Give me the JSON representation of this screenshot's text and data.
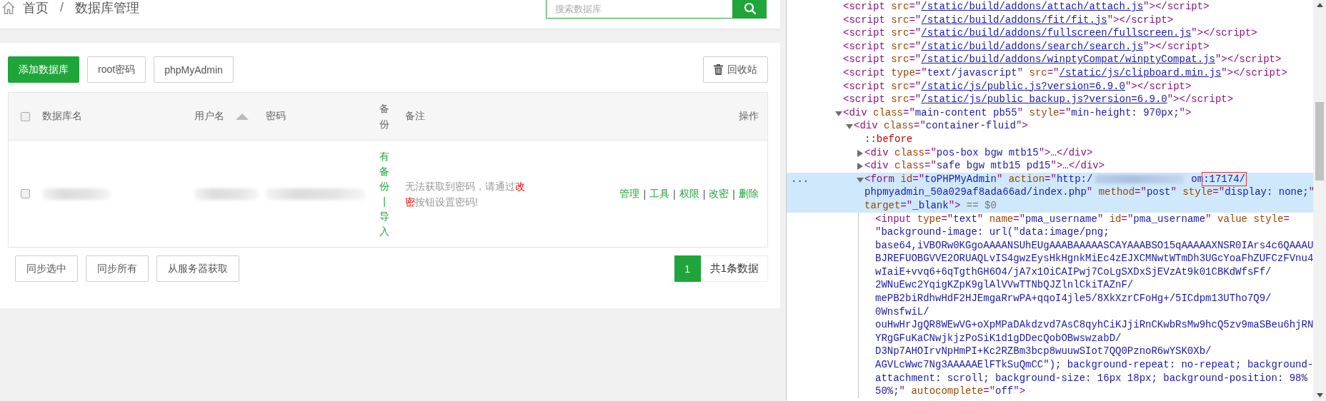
{
  "breadcrumb": {
    "items": [
      "首页",
      "数据库管理"
    ],
    "separator": "/"
  },
  "search": {
    "placeholder": "搜索数据库"
  },
  "toolbar": {
    "buttons": [
      {
        "label": "添加数据库",
        "kind": "primary"
      },
      {
        "label": "root密码",
        "kind": "default"
      },
      {
        "label": "phpMyAdmin",
        "kind": "default"
      }
    ],
    "recycle": "回收站"
  },
  "table": {
    "select_all_checked": false,
    "columns": [
      {
        "label": "数据库名",
        "sorted": false
      },
      {
        "label": "用户名",
        "sorted": true
      },
      {
        "label": "密码",
        "sorted": false
      },
      {
        "label": "备份",
        "sorted": false
      },
      {
        "label": "备注",
        "sorted": false
      },
      {
        "label": "操作",
        "sorted": false
      }
    ],
    "rows": [
      {
        "checked": false,
        "backup_links": [
          "有备份",
          "导入"
        ],
        "backup_separator": "|",
        "note_parts": [
          {
            "kind": "plain",
            "text": "无法获取到密码，请通过"
          },
          {
            "kind": "alert",
            "text": "改密"
          },
          {
            "kind": "plain",
            "text": "按钮设置密码!"
          }
        ],
        "actions": [
          "管理",
          "工具",
          "权限",
          "改密",
          "删除"
        ],
        "action_separator": "|"
      }
    ]
  },
  "footer": {
    "buttons": [
      "同步选中",
      "同步所有",
      "从服务器获取"
    ],
    "pages": [
      {
        "label": "1",
        "selected": true
      }
    ],
    "summary": "共1条数据"
  },
  "devtools": {
    "selected_marker": "...",
    "nodes": [
      {
        "selected": false,
        "parts": [
          {
            "kind": "tag",
            "text": "<script "
          },
          {
            "kind": "attr",
            "text": "src"
          },
          {
            "kind": "p",
            "text": "=\""
          },
          {
            "kind": "link",
            "text": "/static/build/addons/attach/attach.js"
          },
          {
            "kind": "p",
            "text": "\">"
          },
          {
            "kind": "tag",
            "text": "</script>"
          }
        ]
      },
      {
        "selected": false,
        "parts": [
          {
            "kind": "tag",
            "text": "<script "
          },
          {
            "kind": "attr",
            "text": "src"
          },
          {
            "kind": "p",
            "text": "=\""
          },
          {
            "kind": "link",
            "text": "/static/build/addons/fit/fit.js"
          },
          {
            "kind": "p",
            "text": "\">"
          },
          {
            "kind": "tag",
            "text": "</script>"
          }
        ]
      },
      {
        "selected": false,
        "parts": [
          {
            "kind": "tag",
            "text": "<script "
          },
          {
            "kind": "attr",
            "text": "src"
          },
          {
            "kind": "p",
            "text": "=\""
          },
          {
            "kind": "link",
            "text": "/static/build/addons/fullscreen/fullscreen.js"
          },
          {
            "kind": "p",
            "text": "\">"
          },
          {
            "kind": "tag",
            "text": "</script>"
          }
        ]
      },
      {
        "selected": false,
        "parts": [
          {
            "kind": "tag",
            "text": "<script "
          },
          {
            "kind": "attr",
            "text": "src"
          },
          {
            "kind": "p",
            "text": "=\""
          },
          {
            "kind": "link",
            "text": "/static/build/addons/search/search.js"
          },
          {
            "kind": "p",
            "text": "\">"
          },
          {
            "kind": "tag",
            "text": "</script>"
          }
        ]
      },
      {
        "selected": false,
        "parts": [
          {
            "kind": "tag",
            "text": "<script "
          },
          {
            "kind": "attr",
            "text": "src"
          },
          {
            "kind": "p",
            "text": "=\""
          },
          {
            "kind": "link",
            "text": "/static/build/addons/winptyCompat/winptyCompat.js"
          },
          {
            "kind": "p",
            "text": "\">"
          },
          {
            "kind": "tag",
            "text": "</script>"
          }
        ]
      },
      {
        "selected": false,
        "parts": [
          {
            "kind": "tag",
            "text": "<script "
          },
          {
            "kind": "attr",
            "text": "type"
          },
          {
            "kind": "p",
            "text": "=\""
          },
          {
            "kind": "val",
            "text": "text/javascript"
          },
          {
            "kind": "p",
            "text": "\" "
          },
          {
            "kind": "attr",
            "text": "src"
          },
          {
            "kind": "p",
            "text": "=\""
          },
          {
            "kind": "link",
            "text": "/static/js/clipboard.min.js"
          },
          {
            "kind": "p",
            "text": "\">"
          },
          {
            "kind": "tag",
            "text": "</script>"
          }
        ]
      },
      {
        "selected": false,
        "parts": [
          {
            "kind": "tag",
            "text": "<script "
          },
          {
            "kind": "attr",
            "text": "src"
          },
          {
            "kind": "p",
            "text": "=\""
          },
          {
            "kind": "link",
            "text": "/static/js/public.js?version=6.9.0"
          },
          {
            "kind": "p",
            "text": "\">"
          },
          {
            "kind": "tag",
            "text": "</script>"
          }
        ]
      },
      {
        "selected": false,
        "parts": [
          {
            "kind": "tag",
            "text": "<script "
          },
          {
            "kind": "attr",
            "text": "src"
          },
          {
            "kind": "p",
            "text": "=\""
          },
          {
            "kind": "link",
            "text": "/static/js/public_backup.js?version=6.9.0"
          },
          {
            "kind": "p",
            "text": "\">"
          },
          {
            "kind": "tag",
            "text": "</script>"
          }
        ]
      },
      {
        "expanded": true,
        "selected": false,
        "parts": [
          {
            "kind": "tag",
            "text": "<div "
          },
          {
            "kind": "attr",
            "text": "class"
          },
          {
            "kind": "p",
            "text": "=\""
          },
          {
            "kind": "val",
            "text": "main-content pb55"
          },
          {
            "kind": "p",
            "text": "\" "
          },
          {
            "kind": "attr",
            "text": "style"
          },
          {
            "kind": "p",
            "text": "=\""
          },
          {
            "kind": "val",
            "text": "min-height: 970px;"
          },
          {
            "kind": "p",
            "text": "\">"
          }
        ],
        "children": [
          {
            "expanded": true,
            "selected": false,
            "parts": [
              {
                "kind": "tag",
                "text": "<div "
              },
              {
                "kind": "attr",
                "text": "class"
              },
              {
                "kind": "p",
                "text": "=\""
              },
              {
                "kind": "val",
                "text": "container-fluid"
              },
              {
                "kind": "p",
                "text": "\">"
              }
            ],
            "children": [
              {
                "selected": false,
                "parts": [
                  {
                    "kind": "pseudo",
                    "text": "::before"
                  }
                ]
              },
              {
                "expanded": false,
                "selected": false,
                "parts": [
                  {
                    "kind": "tag",
                    "text": "<div "
                  },
                  {
                    "kind": "attr",
                    "text": "class"
                  },
                  {
                    "kind": "p",
                    "text": "=\""
                  },
                  {
                    "kind": "val",
                    "text": "pos-box bgw mtb15"
                  },
                  {
                    "kind": "p",
                    "text": "\">"
                  },
                  {
                    "kind": "plain",
                    "text": "…"
                  },
                  {
                    "kind": "tag",
                    "text": "</div>"
                  }
                ]
              },
              {
                "expanded": false,
                "selected": false,
                "parts": [
                  {
                    "kind": "tag",
                    "text": "<div "
                  },
                  {
                    "kind": "attr",
                    "text": "class"
                  },
                  {
                    "kind": "p",
                    "text": "=\""
                  },
                  {
                    "kind": "val",
                    "text": "safe bgw mtb15 pd15"
                  },
                  {
                    "kind": "p",
                    "text": "\">"
                  },
                  {
                    "kind": "plain",
                    "text": "…"
                  },
                  {
                    "kind": "tag",
                    "text": "</div>"
                  }
                ]
              },
              {
                "expanded": true,
                "selected": true,
                "parts": [
                  {
                    "kind": "tag",
                    "text": "<form "
                  },
                  {
                    "kind": "attr",
                    "text": "id"
                  },
                  {
                    "kind": "p",
                    "text": "=\""
                  },
                  {
                    "kind": "val",
                    "text": "toPHPMyAdmin"
                  },
                  {
                    "kind": "p",
                    "text": "\" "
                  },
                  {
                    "kind": "attr",
                    "text": "action"
                  },
                  {
                    "kind": "p",
                    "text": "=\""
                  },
                  {
                    "kind": "val",
                    "text": "http:/"
                  },
                  {
                    "kind": "blur"
                  },
                  {
                    "kind": "val",
                    "text": "om"
                  },
                  {
                    "kind": "boxed",
                    "text": ":17174/"
                  },
                  {
                    "kind": "val",
                    "text": "\nphpmyadmin_50a029af8ada66ad/index.php"
                  },
                  {
                    "kind": "p",
                    "text": "\" "
                  },
                  {
                    "kind": "attr",
                    "text": "method"
                  },
                  {
                    "kind": "p",
                    "text": "=\""
                  },
                  {
                    "kind": "val",
                    "text": "post"
                  },
                  {
                    "kind": "p",
                    "text": "\" "
                  },
                  {
                    "kind": "attr",
                    "text": "style"
                  },
                  {
                    "kind": "p",
                    "text": "=\""
                  },
                  {
                    "kind": "val",
                    "text": "display: none;"
                  },
                  {
                    "kind": "p",
                    "text": "\"\n"
                  },
                  {
                    "kind": "attr",
                    "text": "target"
                  },
                  {
                    "kind": "p",
                    "text": "=\""
                  },
                  {
                    "kind": "val",
                    "text": "_blank"
                  },
                  {
                    "kind": "p",
                    "text": "\">"
                  },
                  {
                    "kind": "hint",
                    "text": " == $0"
                  }
                ],
                "children": [
                  {
                    "selected": false,
                    "parts": [
                      {
                        "kind": "tag",
                        "text": "<input "
                      },
                      {
                        "kind": "attr",
                        "text": "type"
                      },
                      {
                        "kind": "p",
                        "text": "=\""
                      },
                      {
                        "kind": "val",
                        "text": "text"
                      },
                      {
                        "kind": "p",
                        "text": "\" "
                      },
                      {
                        "kind": "attr",
                        "text": "name"
                      },
                      {
                        "kind": "p",
                        "text": "=\""
                      },
                      {
                        "kind": "val",
                        "text": "pma_username"
                      },
                      {
                        "kind": "p",
                        "text": "\" "
                      },
                      {
                        "kind": "attr",
                        "text": "id"
                      },
                      {
                        "kind": "p",
                        "text": "=\""
                      },
                      {
                        "kind": "val",
                        "text": "pma_username"
                      },
                      {
                        "kind": "p",
                        "text": "\" "
                      },
                      {
                        "kind": "attr",
                        "text": "value style"
                      },
                      {
                        "kind": "p",
                        "text": "=\n\""
                      },
                      {
                        "kind": "val",
                        "text": "background-image: url(\"data:image/png;\nbase64,iVBORw0KGgoAAAANSUhEUgAAABAAAAASCAYAAABSO15qAAAAAXNSR0IArs4c6QAAAU\nBJREFUOBGVVE2ORUAQLvIS4gwzEysHkHgnkMiEc4zEJXCMNwtWTmDh3UGcYoaFhZUFCzFVnu4\nwIaiE+vvq6+6qTgthGH6O4/jA7x1OiCAIPwj7CoLgSXDxSjEVzAt9k01CBKdWfsFf/\n2WNuEwc2YqigKZpK9glAlVVwTTNbQJZlnlCkiTAZnF/\nmePB2biRdhwHdF2HJEmgaRrwPA+qqoI4jle5/8XkXzrCFoHg+/5ICdpm13UTho7Q9/\n0WnsfwiL/\nouHwHrJgQR8WEwVG+oXpMPaDAkdzvd7AsC8qyhCiKJjiRnCKwbRsMw9hcQ5zv9maSBeu6hjRN\nYRgGFuKaCNwjkjzPoSiK1d1gDDecQobOBwswzabD/\nD3Np7AHOIrvNpHmPI+Kc2RZBm3bcp8wuuwSIot7QQ0PznoR6wYSK0Xb/\nAGVLcWwc7Ng3AAAAAElFTkSuQmCC\"); background-repeat: no-repeat; background-\nattachment: scroll; background-size: 16px 18px; background-position: 98%\n50%;"
                      },
                      {
                        "kind": "p",
                        "text": "\" "
                      },
                      {
                        "kind": "attr",
                        "text": "autocomplete"
                      },
                      {
                        "kind": "p",
                        "text": "=\""
                      },
                      {
                        "kind": "val",
                        "text": "off"
                      },
                      {
                        "kind": "p",
                        "text": "\">"
                      }
                    ]
                  }
                ]
              }
            ]
          }
        ]
      }
    ]
  }
}
